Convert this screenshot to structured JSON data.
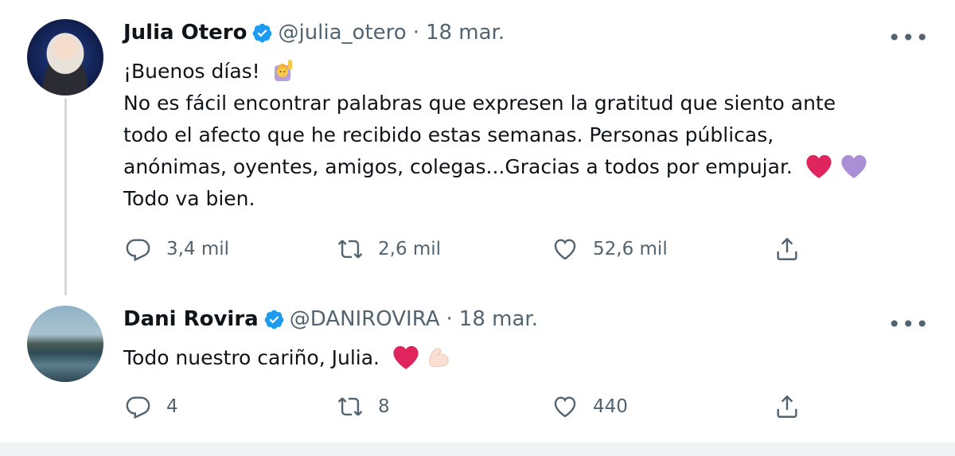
{
  "tweets": [
    {
      "name": "Julia Otero",
      "handle": "@julia_otero",
      "separator": "·",
      "date": "18 mar.",
      "lines": [
        "¡Buenos días!",
        "No es fácil encontrar palabras que expresen  la gratitud que siento ante",
        "todo el afecto que he recibido estas semanas. Personas públicas,",
        "anónimas, oyentes, amigos, colegas...Gracias a todos por empujar.",
        "Todo va bien."
      ],
      "emojis": [
        "raising-hand-emoji",
        "red-heart-emoji",
        "purple-heart-emoji"
      ],
      "replies": "3,4 mil",
      "retweets": "2,6 mil",
      "likes": "52,6 mil"
    },
    {
      "name": "Dani Rovira",
      "handle": "@DANIROVIRA",
      "separator": "·",
      "date": "18 mar.",
      "lines": [
        "Todo nuestro cariño, Julia."
      ],
      "emojis": [
        "red-heart-emoji",
        "flexed-biceps-emoji"
      ],
      "replies": "4",
      "retweets": "8",
      "likes": "440"
    }
  ],
  "icons": [
    "verified-badge-icon",
    "more-options-icon",
    "reply-icon",
    "retweet-icon",
    "like-icon",
    "share-icon"
  ],
  "colors": {
    "verified": "#1d9bf0",
    "text": "#0f1419",
    "muted": "#536471",
    "heart_red": "#e0245e",
    "heart_purple": "#aa8ed6"
  }
}
